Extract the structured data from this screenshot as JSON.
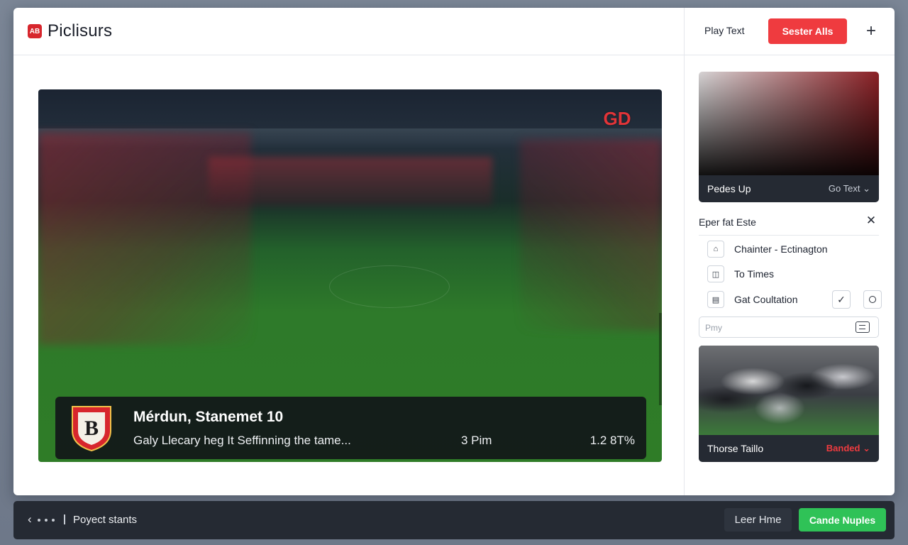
{
  "app": {
    "title": "Piclisurs",
    "logo_text": "AB"
  },
  "header": {
    "play_text": "Play Text",
    "select_button": "Sester Alls",
    "add_icon": "plus-icon"
  },
  "player": {
    "watermark_text": "GD",
    "match_title": "Mérdun, Stanemet 10",
    "match_subtitle": "Galy Llecary heg It Seffinning the tame...",
    "time": "3 Pim",
    "stat": "1.2 8T%",
    "badge_text": "B"
  },
  "sidebar": {
    "color_card": {
      "label": "Pedes Up",
      "select_value": "Go Text"
    },
    "section_title": "Eper fat Este",
    "options": [
      {
        "label": "Chainter - Ectinagton",
        "icon": "home-icon"
      },
      {
        "label": "To Times",
        "icon": "bag-icon"
      },
      {
        "label": "Gat Coultation",
        "icon": "document-icon",
        "checked": true
      }
    ],
    "search": {
      "placeholder": "Pmy",
      "value": ""
    },
    "photo_card": {
      "label": "Thorse Taillo",
      "status": "Banded"
    }
  },
  "footer": {
    "project_status": "Poyect stants",
    "secondary_button": "Leer Hme",
    "primary_button": "Cande Nuples"
  },
  "colors": {
    "accent_red": "#ef3b3f",
    "accent_green": "#2fc257",
    "dark_panel": "#252a33"
  }
}
